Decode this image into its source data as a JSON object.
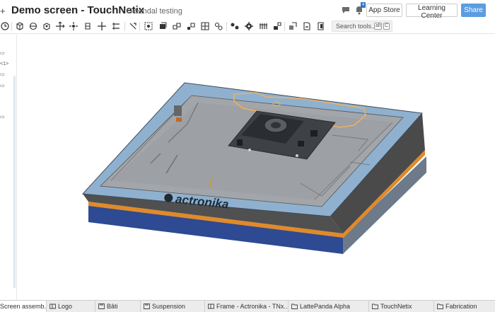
{
  "header": {
    "menu_icon": "plus-icon",
    "document_title": "Demo screen - TouchNetix",
    "workspace_name": "Gwendal testing",
    "notification_count": "4",
    "buttons": {
      "app_store": "App Store",
      "learning_center": "Learning Center",
      "share": "Share"
    }
  },
  "toolbar": {
    "search_placeholder": "Search tools...",
    "shortcut_alt": "alt",
    "shortcut_c": "C"
  },
  "left_panel": {
    "feature_label": "<1>"
  },
  "tabs": [
    {
      "label": "Screen assemb...",
      "icon": "assembly-icon",
      "active": true
    },
    {
      "label": "Logo",
      "icon": "part-studio-icon",
      "active": false
    },
    {
      "label": "Bâti",
      "icon": "part-studio-icon",
      "active": false
    },
    {
      "label": "Suspension",
      "icon": "part-studio-icon",
      "active": false
    },
    {
      "label": "Frame - Actronika - TNx...",
      "icon": "part-studio-icon",
      "active": false
    },
    {
      "label": "LattePanda Alpha",
      "icon": "folder-icon",
      "active": false
    },
    {
      "label": "TouchNetix",
      "icon": "folder-icon",
      "active": false
    },
    {
      "label": "Fabrication",
      "icon": "folder-icon",
      "active": false
    }
  ],
  "model": {
    "logo_text": "actronika"
  },
  "colors": {
    "share_button": "#5b9de0",
    "frame_blue": "#8fb1cf",
    "base_navy": "#2d4a93",
    "accent_orange": "#e08a2a"
  }
}
